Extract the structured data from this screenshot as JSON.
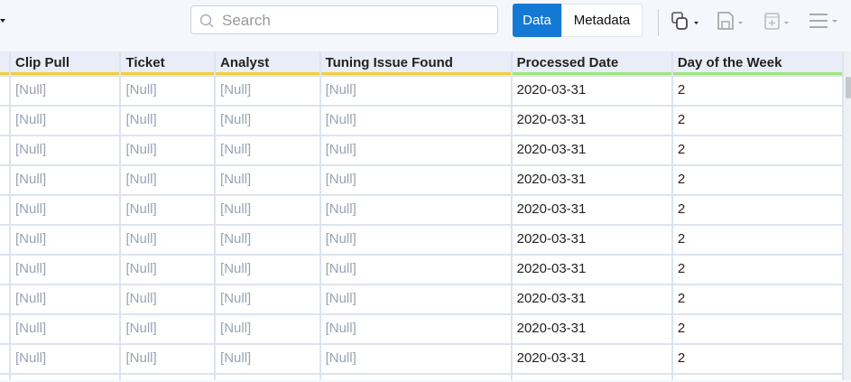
{
  "toolbar": {
    "search_placeholder": "Search",
    "data_label": "Data",
    "metadata_label": "Metadata"
  },
  "table": {
    "columns": [
      "",
      "Clip Pull",
      "Ticket",
      "Analyst",
      "Tuning Issue Found",
      "Processed Date",
      "Day of the Week"
    ],
    "rows": [
      [
        "",
        "[Null]",
        "[Null]",
        "[Null]",
        "[Null]",
        "2020-03-31",
        "2"
      ],
      [
        "",
        "[Null]",
        "[Null]",
        "[Null]",
        "[Null]",
        "2020-03-31",
        "2"
      ],
      [
        "",
        "[Null]",
        "[Null]",
        "[Null]",
        "[Null]",
        "2020-03-31",
        "2"
      ],
      [
        "",
        "[Null]",
        "[Null]",
        "[Null]",
        "[Null]",
        "2020-03-31",
        "2"
      ],
      [
        "",
        "[Null]",
        "[Null]",
        "[Null]",
        "[Null]",
        "2020-03-31",
        "2"
      ],
      [
        "",
        "[Null]",
        "[Null]",
        "[Null]",
        "[Null]",
        "2020-03-31",
        "2"
      ],
      [
        "",
        "[Null]",
        "[Null]",
        "[Null]",
        "[Null]",
        "2020-03-31",
        "2"
      ],
      [
        "",
        "[Null]",
        "[Null]",
        "[Null]",
        "[Null]",
        "2020-03-31",
        "2"
      ],
      [
        "",
        "[Null]",
        "[Null]",
        "[Null]",
        "[Null]",
        "2020-03-31",
        "2"
      ],
      [
        "",
        "[Null]",
        "[Null]",
        "[Null]",
        "[Null]",
        "2020-03-31",
        "2"
      ],
      [
        "",
        "",
        "",
        "",
        "",
        "",
        ""
      ]
    ]
  },
  "colors": {
    "accent": "#1479d4",
    "string_type": "#f2cf38",
    "date_type": "#9ee57a"
  }
}
